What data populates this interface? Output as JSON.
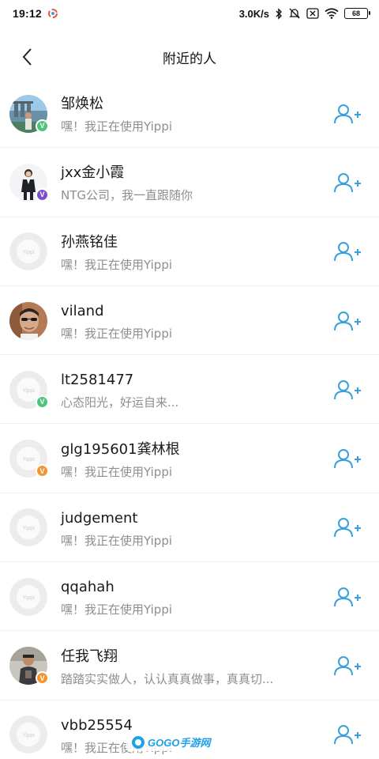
{
  "status_bar": {
    "time": "19:12",
    "net_speed": "3.0K/s",
    "battery": "68",
    "icons": [
      "app-notification-icon",
      "bluetooth-icon",
      "mute-icon",
      "sim-icon",
      "wifi-icon",
      "battery-icon"
    ]
  },
  "nav": {
    "title": "附近的人",
    "back_icon": "chevron-left-icon"
  },
  "colors": {
    "accent": "#3aa0dc",
    "badge_green": "#4cc47a",
    "badge_purple": "#7b4fc9",
    "badge_orange": "#f0962e",
    "divider": "#f1f1f1",
    "subtitle": "#8e8e8e"
  },
  "users": [
    {
      "name": "邹焕松",
      "status": "嘿！我正在使用Yippi",
      "avatar": "photo-landscape",
      "badge": "green"
    },
    {
      "name": "jxx金小霞",
      "status": "NTG公司，我一直跟随你",
      "avatar": "photo-woman",
      "badge": "purple"
    },
    {
      "name": "孙燕铭佳",
      "status": "嘿！我正在使用Yippi",
      "avatar": "default",
      "badge": ""
    },
    {
      "name": "viland",
      "status": "嘿！我正在使用Yippi",
      "avatar": "photo-man",
      "badge": ""
    },
    {
      "name": "lt2581477",
      "status": "心态阳光，好运自来...",
      "avatar": "default",
      "badge": "green"
    },
    {
      "name": "glg195601龚林根",
      "status": "嘿！我正在使用Yippi",
      "avatar": "default",
      "badge": "orange"
    },
    {
      "name": "judgement",
      "status": "嘿！我正在使用Yippi",
      "avatar": "default",
      "badge": ""
    },
    {
      "name": "qqahah",
      "status": "嘿！我正在使用Yippi",
      "avatar": "default",
      "badge": ""
    },
    {
      "name": "任我飞翔",
      "status": "踏踏实实做人，认认真真做事，真真切...",
      "avatar": "photo-man2",
      "badge": "orange"
    },
    {
      "name": "vbb25554",
      "status": "嘿！我正在使用Yippi",
      "avatar": "default",
      "badge": ""
    }
  ],
  "badge_letter": "V",
  "default_avatar_text": "Yippi",
  "watermark": "GOGO手游网"
}
